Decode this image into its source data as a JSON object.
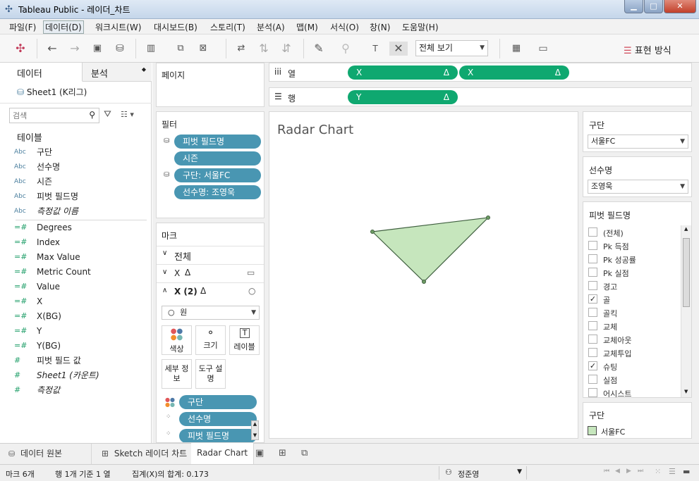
{
  "window": {
    "title": "Tableau Public - 레이더_차트"
  },
  "menu": [
    "파일(F)",
    "데이터(D)",
    "워크시트(W)",
    "대시보드(B)",
    "스토리(T)",
    "분석(A)",
    "맵(M)",
    "서식(O)",
    "창(N)",
    "도움말(H)"
  ],
  "toolbar": {
    "view_select": "전체 보기",
    "show_me": "표현 방식"
  },
  "data_pane": {
    "tab_data": "데이터",
    "tab_analysis": "분석",
    "datasource": "Sheet1 (K리그)",
    "search_placeholder": "검색",
    "tables_heading": "테이블",
    "dimensions": [
      {
        "type": "Abc",
        "name": "구단",
        "italic": false
      },
      {
        "type": "Abc",
        "name": "선수명",
        "italic": false
      },
      {
        "type": "Abc",
        "name": "시즌",
        "italic": false
      },
      {
        "type": "Abc",
        "name": "피벗 필드명",
        "italic": false
      },
      {
        "type": "Abc",
        "name": "측정값 이름",
        "italic": true
      }
    ],
    "measures": [
      {
        "type": "=#",
        "name": "Degrees",
        "italic": false
      },
      {
        "type": "=#",
        "name": "Index",
        "italic": false
      },
      {
        "type": "=#",
        "name": "Max Value",
        "italic": false
      },
      {
        "type": "=#",
        "name": "Metric Count",
        "italic": false
      },
      {
        "type": "=#",
        "name": "Value",
        "italic": false
      },
      {
        "type": "=#",
        "name": "X",
        "italic": false
      },
      {
        "type": "=#",
        "name": "X(BG)",
        "italic": false
      },
      {
        "type": "=#",
        "name": "Y",
        "italic": false
      },
      {
        "type": "=#",
        "name": "Y(BG)",
        "italic": false
      },
      {
        "type": "#",
        "name": "피벗 필드 값",
        "italic": false
      },
      {
        "type": "#",
        "name": "Sheet1 (카운트)",
        "italic": true
      },
      {
        "type": "#",
        "name": "측정값",
        "italic": true
      }
    ]
  },
  "pages": {
    "label": "페이지"
  },
  "filters": {
    "label": "필터",
    "items": [
      "피벗 필드명",
      "시즌",
      "구단: 서울FC",
      "선수명: 조영욱"
    ]
  },
  "marks": {
    "label": "마크",
    "all": "전체",
    "x": "X",
    "x2": "X (2)",
    "mark_type": "원",
    "buttons": [
      "색상",
      "크기",
      "레이블",
      "세부 정보",
      "도구 설명"
    ],
    "pills": [
      "구단",
      "선수명",
      "피벗 필드명"
    ]
  },
  "shelves": {
    "columns_label": "열",
    "rows_label": "행",
    "columns": [
      "X",
      "X"
    ],
    "rows": [
      "Y"
    ]
  },
  "view": {
    "title": "Radar Chart",
    "fill": "#c6e6bd",
    "stroke": "#3f5f3f"
  },
  "right": {
    "club_label": "구단",
    "club_value": "서울FC",
    "player_label": "선수명",
    "player_value": "조영욱",
    "pivot_label": "피벗 필드명",
    "pivot_items": [
      {
        "label": "(전체)",
        "checked": false
      },
      {
        "label": "Pk 득점",
        "checked": false
      },
      {
        "label": "Pk 성공률",
        "checked": false
      },
      {
        "label": "Pk 실점",
        "checked": false
      },
      {
        "label": "경고",
        "checked": false
      },
      {
        "label": "골",
        "checked": true
      },
      {
        "label": "골킥",
        "checked": false
      },
      {
        "label": "교체",
        "checked": false
      },
      {
        "label": "교체아웃",
        "checked": false
      },
      {
        "label": "교체투입",
        "checked": false
      },
      {
        "label": "슈팅",
        "checked": true
      },
      {
        "label": "실점",
        "checked": false
      },
      {
        "label": "어시스트",
        "checked": false
      }
    ],
    "legend_label": "구단",
    "legend_item": "서울FC"
  },
  "tabs": [
    "데이터 원본",
    "Sketch 레이더 차트",
    "Radar Chart"
  ],
  "status": {
    "marks": "마크 6개",
    "rowscols": "행 1개 기준 1 열",
    "sum": "집계(X)의 합계: 0.173",
    "user": "정준영"
  }
}
